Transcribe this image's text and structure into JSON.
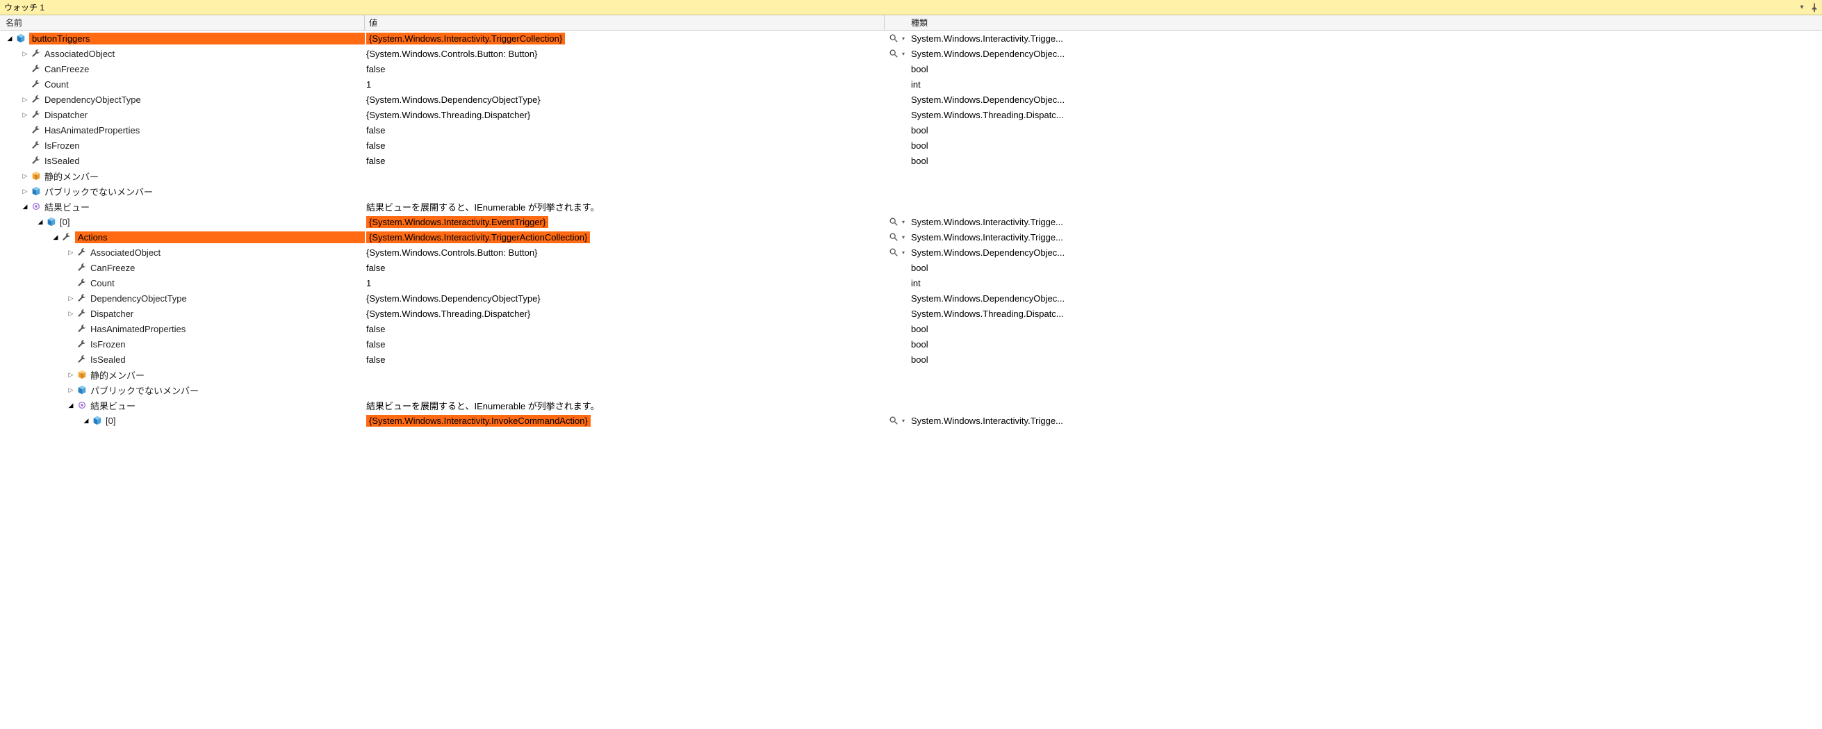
{
  "titlebar": {
    "title": "ウォッチ 1"
  },
  "header": {
    "name": "名前",
    "value": "値",
    "type": "種類"
  },
  "rows": [
    {
      "depth": 0,
      "expander": "open",
      "icon": "cube-blue",
      "name": "buttonTriggers",
      "hlName": true,
      "value": "{System.Windows.Interactivity.TriggerCollection}",
      "hlValue": true,
      "magnifier": true,
      "type": "System.Windows.Interactivity.Trigge..."
    },
    {
      "depth": 1,
      "expander": "closed",
      "icon": "wrench",
      "name": "AssociatedObject",
      "hlName": false,
      "value": "{System.Windows.Controls.Button: Button}",
      "hlValue": false,
      "magnifier": true,
      "type": "System.Windows.DependencyObjec..."
    },
    {
      "depth": 1,
      "expander": "none",
      "icon": "wrench",
      "name": "CanFreeze",
      "hlName": false,
      "value": "false",
      "hlValue": false,
      "magnifier": false,
      "type": "bool"
    },
    {
      "depth": 1,
      "expander": "none",
      "icon": "wrench",
      "name": "Count",
      "hlName": false,
      "value": "1",
      "hlValue": false,
      "magnifier": false,
      "type": "int"
    },
    {
      "depth": 1,
      "expander": "closed",
      "icon": "wrench",
      "name": "DependencyObjectType",
      "hlName": false,
      "value": "{System.Windows.DependencyObjectType}",
      "hlValue": false,
      "magnifier": false,
      "type": "System.Windows.DependencyObjec..."
    },
    {
      "depth": 1,
      "expander": "closed",
      "icon": "wrench",
      "name": "Dispatcher",
      "hlName": false,
      "value": "{System.Windows.Threading.Dispatcher}",
      "hlValue": false,
      "magnifier": false,
      "type": "System.Windows.Threading.Dispatc..."
    },
    {
      "depth": 1,
      "expander": "none",
      "icon": "wrench",
      "name": "HasAnimatedProperties",
      "hlName": false,
      "value": "false",
      "hlValue": false,
      "magnifier": false,
      "type": "bool"
    },
    {
      "depth": 1,
      "expander": "none",
      "icon": "wrench",
      "name": "IsFrozen",
      "hlName": false,
      "value": "false",
      "hlValue": false,
      "magnifier": false,
      "type": "bool"
    },
    {
      "depth": 1,
      "expander": "none",
      "icon": "wrench",
      "name": "IsSealed",
      "hlName": false,
      "value": "false",
      "hlValue": false,
      "magnifier": false,
      "type": "bool"
    },
    {
      "depth": 1,
      "expander": "closed",
      "icon": "static",
      "name": "静的メンバー",
      "hlName": false,
      "value": "",
      "hlValue": false,
      "magnifier": false,
      "type": ""
    },
    {
      "depth": 1,
      "expander": "closed",
      "icon": "cube-blue",
      "name": "パブリックでないメンバー",
      "hlName": false,
      "value": "",
      "hlValue": false,
      "magnifier": false,
      "type": ""
    },
    {
      "depth": 1,
      "expander": "open",
      "icon": "results-view",
      "name": "結果ビュー",
      "hlName": false,
      "value": "結果ビューを展開すると、IEnumerable が列挙されます。",
      "hlValue": false,
      "magnifier": false,
      "type": ""
    },
    {
      "depth": 2,
      "expander": "open",
      "icon": "cube-blue",
      "name": "[0]",
      "hlName": false,
      "value": "{System.Windows.Interactivity.EventTrigger}",
      "hlValue": true,
      "magnifier": true,
      "type": "System.Windows.Interactivity.Trigge..."
    },
    {
      "depth": 3,
      "expander": "open",
      "icon": "wrench",
      "name": "Actions",
      "hlName": true,
      "value": "{System.Windows.Interactivity.TriggerActionCollection}",
      "hlValue": true,
      "magnifier": true,
      "type": "System.Windows.Interactivity.Trigge..."
    },
    {
      "depth": 4,
      "expander": "closed",
      "icon": "wrench",
      "name": "AssociatedObject",
      "hlName": false,
      "value": "{System.Windows.Controls.Button: Button}",
      "hlValue": false,
      "magnifier": true,
      "type": "System.Windows.DependencyObjec..."
    },
    {
      "depth": 4,
      "expander": "none",
      "icon": "wrench",
      "name": "CanFreeze",
      "hlName": false,
      "value": "false",
      "hlValue": false,
      "magnifier": false,
      "type": "bool"
    },
    {
      "depth": 4,
      "expander": "none",
      "icon": "wrench",
      "name": "Count",
      "hlName": false,
      "value": "1",
      "hlValue": false,
      "magnifier": false,
      "type": "int"
    },
    {
      "depth": 4,
      "expander": "closed",
      "icon": "wrench",
      "name": "DependencyObjectType",
      "hlName": false,
      "value": "{System.Windows.DependencyObjectType}",
      "hlValue": false,
      "magnifier": false,
      "type": "System.Windows.DependencyObjec..."
    },
    {
      "depth": 4,
      "expander": "closed",
      "icon": "wrench",
      "name": "Dispatcher",
      "hlName": false,
      "value": "{System.Windows.Threading.Dispatcher}",
      "hlValue": false,
      "magnifier": false,
      "type": "System.Windows.Threading.Dispatc..."
    },
    {
      "depth": 4,
      "expander": "none",
      "icon": "wrench",
      "name": "HasAnimatedProperties",
      "hlName": false,
      "value": "false",
      "hlValue": false,
      "magnifier": false,
      "type": "bool"
    },
    {
      "depth": 4,
      "expander": "none",
      "icon": "wrench",
      "name": "IsFrozen",
      "hlName": false,
      "value": "false",
      "hlValue": false,
      "magnifier": false,
      "type": "bool"
    },
    {
      "depth": 4,
      "expander": "none",
      "icon": "wrench",
      "name": "IsSealed",
      "hlName": false,
      "value": "false",
      "hlValue": false,
      "magnifier": false,
      "type": "bool"
    },
    {
      "depth": 4,
      "expander": "closed",
      "icon": "static",
      "name": "静的メンバー",
      "hlName": false,
      "value": "",
      "hlValue": false,
      "magnifier": false,
      "type": ""
    },
    {
      "depth": 4,
      "expander": "closed",
      "icon": "cube-blue",
      "name": "パブリックでないメンバー",
      "hlName": false,
      "value": "",
      "hlValue": false,
      "magnifier": false,
      "type": ""
    },
    {
      "depth": 4,
      "expander": "open",
      "icon": "results-view",
      "name": "結果ビュー",
      "hlName": false,
      "value": "結果ビューを展開すると、IEnumerable が列挙されます。",
      "hlValue": false,
      "magnifier": false,
      "type": ""
    },
    {
      "depth": 5,
      "expander": "open",
      "icon": "cube-blue",
      "name": "[0]",
      "hlName": false,
      "value": "{System.Windows.Interactivity.InvokeCommandAction}",
      "hlValue": true,
      "magnifier": true,
      "type": "System.Windows.Interactivity.Trigge..."
    }
  ]
}
